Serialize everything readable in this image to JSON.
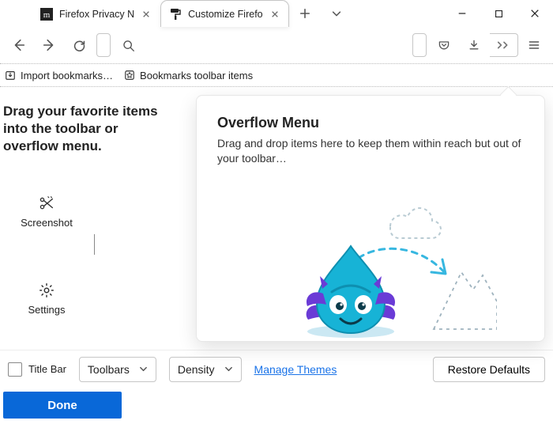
{
  "tabs": [
    {
      "title": "Firefox Privacy N",
      "active": false
    },
    {
      "title": "Customize Firefo",
      "active": true
    }
  ],
  "bookmarks_toolbar": {
    "import": "Import bookmarks…",
    "items_label": "Bookmarks toolbar items"
  },
  "customize": {
    "instruction": "Drag your favorite items into the toolbar or overflow menu.",
    "palette": [
      {
        "label": "Screenshot",
        "icon": "scissors-icon"
      },
      {
        "label": "Settings",
        "icon": "gear-icon"
      }
    ],
    "overflow": {
      "title": "Overflow Menu",
      "desc": "Drag and drop items here to keep them within reach but out of your toolbar…"
    }
  },
  "footer": {
    "titlebar_label": "Title Bar",
    "toolbars_label": "Toolbars",
    "density_label": "Density",
    "manage_themes": "Manage Themes",
    "restore_defaults": "Restore Defaults",
    "done": "Done"
  }
}
